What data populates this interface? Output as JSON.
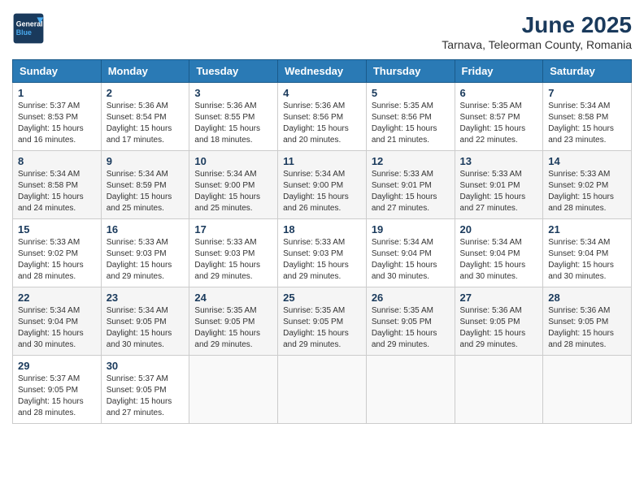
{
  "header": {
    "logo_line1": "General",
    "logo_line2": "Blue",
    "main_title": "June 2025",
    "subtitle": "Tarnava, Teleorman County, Romania"
  },
  "calendar": {
    "days_of_week": [
      "Sunday",
      "Monday",
      "Tuesday",
      "Wednesday",
      "Thursday",
      "Friday",
      "Saturday"
    ],
    "weeks": [
      [
        null,
        null,
        null,
        null,
        null,
        null,
        null
      ]
    ],
    "cells": [
      {
        "day": 1,
        "col": 0,
        "sunrise": "5:37 AM",
        "sunset": "8:53 PM",
        "daylight": "15 hours and 16 minutes."
      },
      {
        "day": 2,
        "col": 1,
        "sunrise": "5:36 AM",
        "sunset": "8:54 PM",
        "daylight": "15 hours and 17 minutes."
      },
      {
        "day": 3,
        "col": 2,
        "sunrise": "5:36 AM",
        "sunset": "8:55 PM",
        "daylight": "15 hours and 18 minutes."
      },
      {
        "day": 4,
        "col": 3,
        "sunrise": "5:36 AM",
        "sunset": "8:56 PM",
        "daylight": "15 hours and 20 minutes."
      },
      {
        "day": 5,
        "col": 4,
        "sunrise": "5:35 AM",
        "sunset": "8:56 PM",
        "daylight": "15 hours and 21 minutes."
      },
      {
        "day": 6,
        "col": 5,
        "sunrise": "5:35 AM",
        "sunset": "8:57 PM",
        "daylight": "15 hours and 22 minutes."
      },
      {
        "day": 7,
        "col": 6,
        "sunrise": "5:34 AM",
        "sunset": "8:58 PM",
        "daylight": "15 hours and 23 minutes."
      },
      {
        "day": 8,
        "col": 0,
        "sunrise": "5:34 AM",
        "sunset": "8:58 PM",
        "daylight": "15 hours and 24 minutes."
      },
      {
        "day": 9,
        "col": 1,
        "sunrise": "5:34 AM",
        "sunset": "8:59 PM",
        "daylight": "15 hours and 25 minutes."
      },
      {
        "day": 10,
        "col": 2,
        "sunrise": "5:34 AM",
        "sunset": "9:00 PM",
        "daylight": "15 hours and 25 minutes."
      },
      {
        "day": 11,
        "col": 3,
        "sunrise": "5:34 AM",
        "sunset": "9:00 PM",
        "daylight": "15 hours and 26 minutes."
      },
      {
        "day": 12,
        "col": 4,
        "sunrise": "5:33 AM",
        "sunset": "9:01 PM",
        "daylight": "15 hours and 27 minutes."
      },
      {
        "day": 13,
        "col": 5,
        "sunrise": "5:33 AM",
        "sunset": "9:01 PM",
        "daylight": "15 hours and 27 minutes."
      },
      {
        "day": 14,
        "col": 6,
        "sunrise": "5:33 AM",
        "sunset": "9:02 PM",
        "daylight": "15 hours and 28 minutes."
      },
      {
        "day": 15,
        "col": 0,
        "sunrise": "5:33 AM",
        "sunset": "9:02 PM",
        "daylight": "15 hours and 28 minutes."
      },
      {
        "day": 16,
        "col": 1,
        "sunrise": "5:33 AM",
        "sunset": "9:03 PM",
        "daylight": "15 hours and 29 minutes."
      },
      {
        "day": 17,
        "col": 2,
        "sunrise": "5:33 AM",
        "sunset": "9:03 PM",
        "daylight": "15 hours and 29 minutes."
      },
      {
        "day": 18,
        "col": 3,
        "sunrise": "5:33 AM",
        "sunset": "9:03 PM",
        "daylight": "15 hours and 29 minutes."
      },
      {
        "day": 19,
        "col": 4,
        "sunrise": "5:34 AM",
        "sunset": "9:04 PM",
        "daylight": "15 hours and 30 minutes."
      },
      {
        "day": 20,
        "col": 5,
        "sunrise": "5:34 AM",
        "sunset": "9:04 PM",
        "daylight": "15 hours and 30 minutes."
      },
      {
        "day": 21,
        "col": 6,
        "sunrise": "5:34 AM",
        "sunset": "9:04 PM",
        "daylight": "15 hours and 30 minutes."
      },
      {
        "day": 22,
        "col": 0,
        "sunrise": "5:34 AM",
        "sunset": "9:04 PM",
        "daylight": "15 hours and 30 minutes."
      },
      {
        "day": 23,
        "col": 1,
        "sunrise": "5:34 AM",
        "sunset": "9:05 PM",
        "daylight": "15 hours and 30 minutes."
      },
      {
        "day": 24,
        "col": 2,
        "sunrise": "5:35 AM",
        "sunset": "9:05 PM",
        "daylight": "15 hours and 29 minutes."
      },
      {
        "day": 25,
        "col": 3,
        "sunrise": "5:35 AM",
        "sunset": "9:05 PM",
        "daylight": "15 hours and 29 minutes."
      },
      {
        "day": 26,
        "col": 4,
        "sunrise": "5:35 AM",
        "sunset": "9:05 PM",
        "daylight": "15 hours and 29 minutes."
      },
      {
        "day": 27,
        "col": 5,
        "sunrise": "5:36 AM",
        "sunset": "9:05 PM",
        "daylight": "15 hours and 29 minutes."
      },
      {
        "day": 28,
        "col": 6,
        "sunrise": "5:36 AM",
        "sunset": "9:05 PM",
        "daylight": "15 hours and 28 minutes."
      },
      {
        "day": 29,
        "col": 0,
        "sunrise": "5:37 AM",
        "sunset": "9:05 PM",
        "daylight": "15 hours and 28 minutes."
      },
      {
        "day": 30,
        "col": 1,
        "sunrise": "5:37 AM",
        "sunset": "9:05 PM",
        "daylight": "15 hours and 27 minutes."
      }
    ]
  }
}
